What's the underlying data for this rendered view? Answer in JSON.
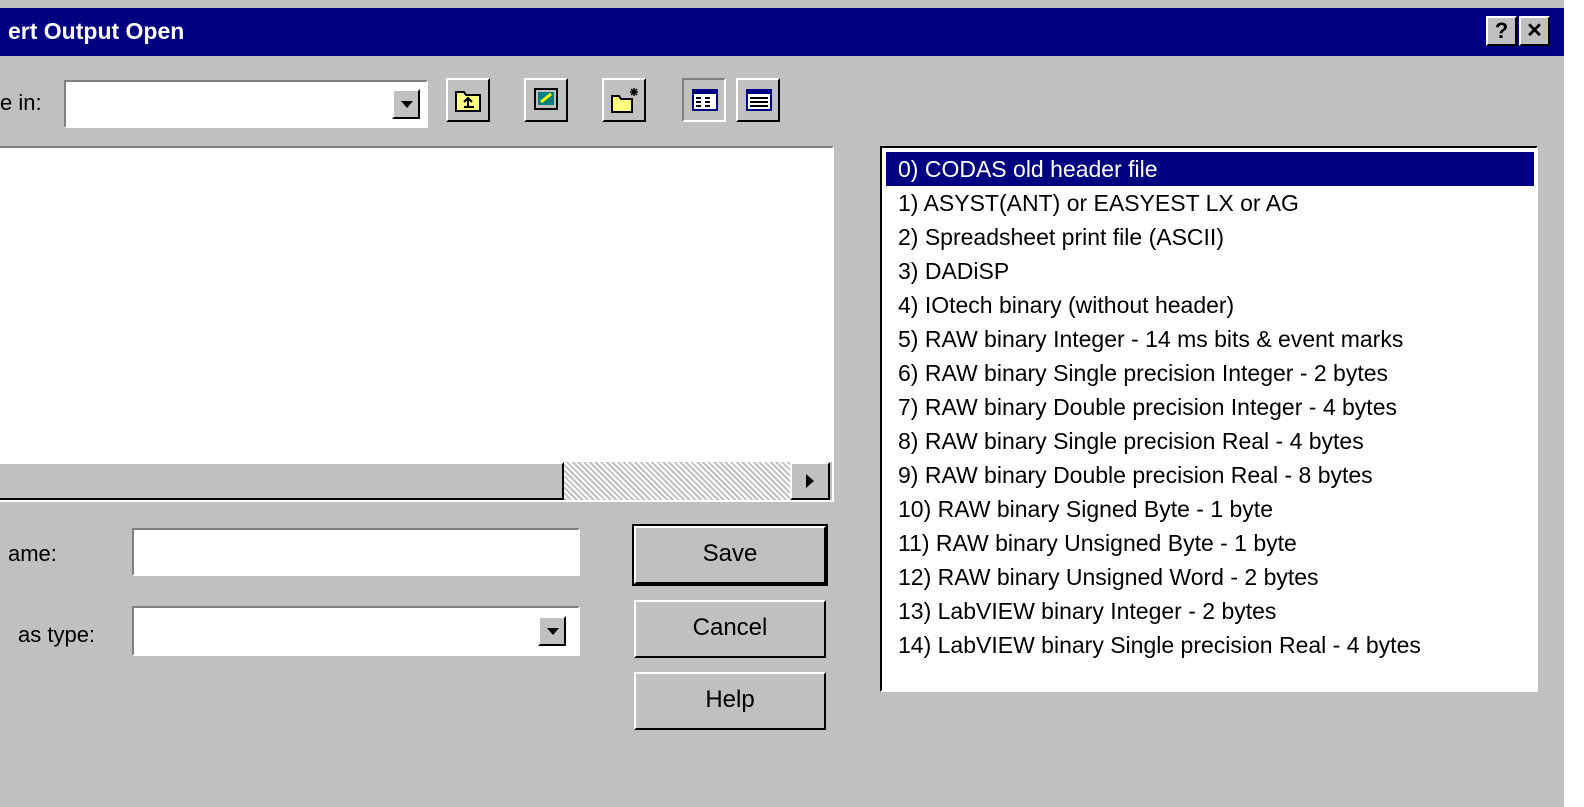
{
  "window": {
    "title": "ert Output Open",
    "help_btn": "?",
    "close_btn": "✕"
  },
  "save_in": {
    "label": "e in:",
    "value": ""
  },
  "toolbar": [
    {
      "name": "up-folder-icon"
    },
    {
      "name": "desktop-icon"
    },
    {
      "name": "new-folder-icon"
    },
    {
      "name": "list-view-icon"
    },
    {
      "name": "details-view-icon"
    }
  ],
  "filename": {
    "label": "ame:",
    "value": ""
  },
  "filetype": {
    "label": "as type:",
    "value": ""
  },
  "buttons": {
    "save": "Save",
    "cancel": "Cancel",
    "help": "Help"
  },
  "formats": {
    "selected_index": 0,
    "items": [
      "0) CODAS old header file",
      "1) ASYST(ANT) or EASYEST LX or AG",
      "2) Spreadsheet print file (ASCII)",
      "3) DADiSP",
      "4) IOtech binary (without header)",
      "5) RAW binary Integer - 14 ms bits & event marks",
      "6) RAW binary Single precision Integer - 2 bytes",
      "7) RAW binary Double precision Integer - 4 bytes",
      "8) RAW binary Single precision Real - 4 bytes",
      "9) RAW binary Double precision Real - 8 bytes",
      "10) RAW binary Signed Byte - 1 byte",
      "11) RAW binary Unsigned Byte - 1 byte",
      "12) RAW binary Unsigned Word - 2 bytes",
      "13) LabVIEW binary Integer - 2 bytes",
      "14) LabVIEW binary Single precision Real - 4 bytes"
    ]
  }
}
